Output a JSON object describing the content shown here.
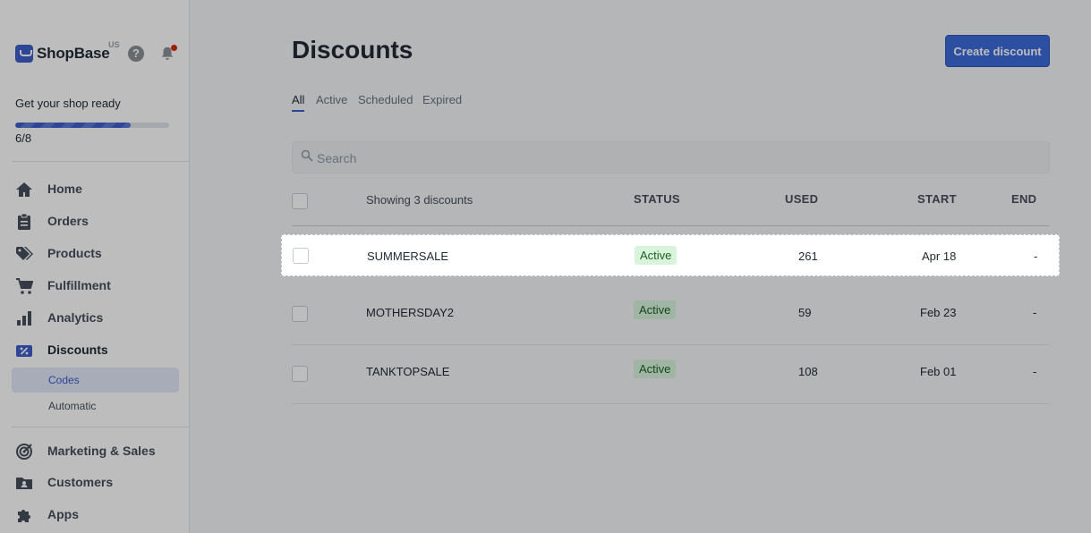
{
  "app": {
    "brand": "ShopBase",
    "region": "US",
    "help_icon": "question-circle-icon",
    "notification_icon": "bell-icon"
  },
  "setup": {
    "title": "Get your shop ready",
    "count": "6/8",
    "progress": 0.75
  },
  "nav": {
    "items": [
      {
        "label": "Home",
        "icon": "home-icon"
      },
      {
        "label": "Orders",
        "icon": "orders-clipboard-icon"
      },
      {
        "label": "Products",
        "icon": "tags-icon"
      },
      {
        "label": "Fulfillment",
        "icon": "cart-icon"
      },
      {
        "label": "Analytics",
        "icon": "bar-chart-icon"
      },
      {
        "label": "Discounts",
        "icon": "discount-icon"
      },
      {
        "label": "Marketing & Sales",
        "icon": "target-icon"
      },
      {
        "label": "Customers",
        "icon": "customers-folder-icon"
      },
      {
        "label": "Apps",
        "icon": "puzzle-icon"
      }
    ],
    "discount_sub": [
      {
        "label": "Codes"
      },
      {
        "label": "Automatic"
      }
    ]
  },
  "page": {
    "title": "Discounts",
    "create_button": "Create discount",
    "tabs": [
      {
        "label": "All"
      },
      {
        "label": "Active"
      },
      {
        "label": "Scheduled"
      },
      {
        "label": "Expired"
      }
    ],
    "search_placeholder": "Search"
  },
  "table": {
    "showing": "Showing 3 discounts",
    "headers": {
      "status": "STATUS",
      "used": "USED",
      "start": "START",
      "end": "END"
    },
    "rows": [
      {
        "code": "SUMMERSALE",
        "status": "Active",
        "used": "261",
        "start": "Apr 18",
        "end": "-"
      },
      {
        "code": "MOTHERSDAY2",
        "status": "Active",
        "used": "59",
        "start": "Feb 23",
        "end": "-"
      },
      {
        "code": "TANKTOPSALE",
        "status": "Active",
        "used": "108",
        "start": "Feb 01",
        "end": "-"
      }
    ]
  },
  "colors": {
    "accent": "#3d5fc9",
    "button": "#3d6bdb",
    "active_badge_bg": "#d8f5dc",
    "active_badge_text": "#1c5f25"
  }
}
